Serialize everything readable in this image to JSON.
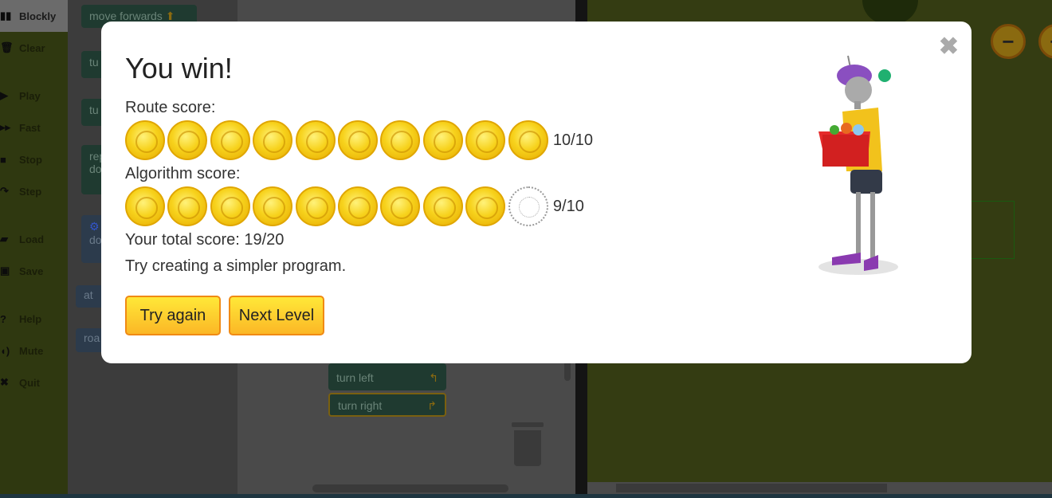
{
  "sidebar": {
    "items": [
      {
        "label": "Blockly",
        "icon": "blockly-icon",
        "glyph": "▮▮"
      },
      {
        "label": "Clear",
        "icon": "trash-icon",
        "glyph": "🗑"
      },
      {
        "label": "Play",
        "icon": "play-icon",
        "glyph": "▶"
      },
      {
        "label": "Fast",
        "icon": "fast-forward-icon",
        "glyph": "▸▸"
      },
      {
        "label": "Stop",
        "icon": "stop-icon",
        "glyph": "■"
      },
      {
        "label": "Step",
        "icon": "step-icon",
        "glyph": "↷"
      },
      {
        "label": "Load",
        "icon": "folder-icon",
        "glyph": "▰"
      },
      {
        "label": "Save",
        "icon": "save-icon",
        "glyph": "▣"
      },
      {
        "label": "Help",
        "icon": "help-icon",
        "glyph": "?"
      },
      {
        "label": "Mute",
        "icon": "speaker-icon",
        "glyph": "◖)"
      },
      {
        "label": "Quit",
        "icon": "close-icon",
        "glyph": "✖"
      }
    ]
  },
  "toolbox": {
    "blocks": [
      "move forwards",
      "tu",
      "tu",
      "rep",
      "do",
      "do",
      "at",
      "roa"
    ]
  },
  "workspace": {
    "blocks": [
      "turn left",
      "turn right"
    ]
  },
  "modal": {
    "title": "You win!",
    "route_label": "Route score:",
    "route_score": "10/10",
    "route_value": 10,
    "algorithm_label": "Algorithm score:",
    "algorithm_score": "9/10",
    "algorithm_value": 9,
    "max": 10,
    "total": "Your total score: 19/20",
    "hint": "Try creating a simpler program.",
    "try_again": "Try again",
    "next_level": "Next Level"
  },
  "colors": {
    "coin": "#f7d21c",
    "button": "#fcc92c",
    "button_border": "#f08a14"
  }
}
